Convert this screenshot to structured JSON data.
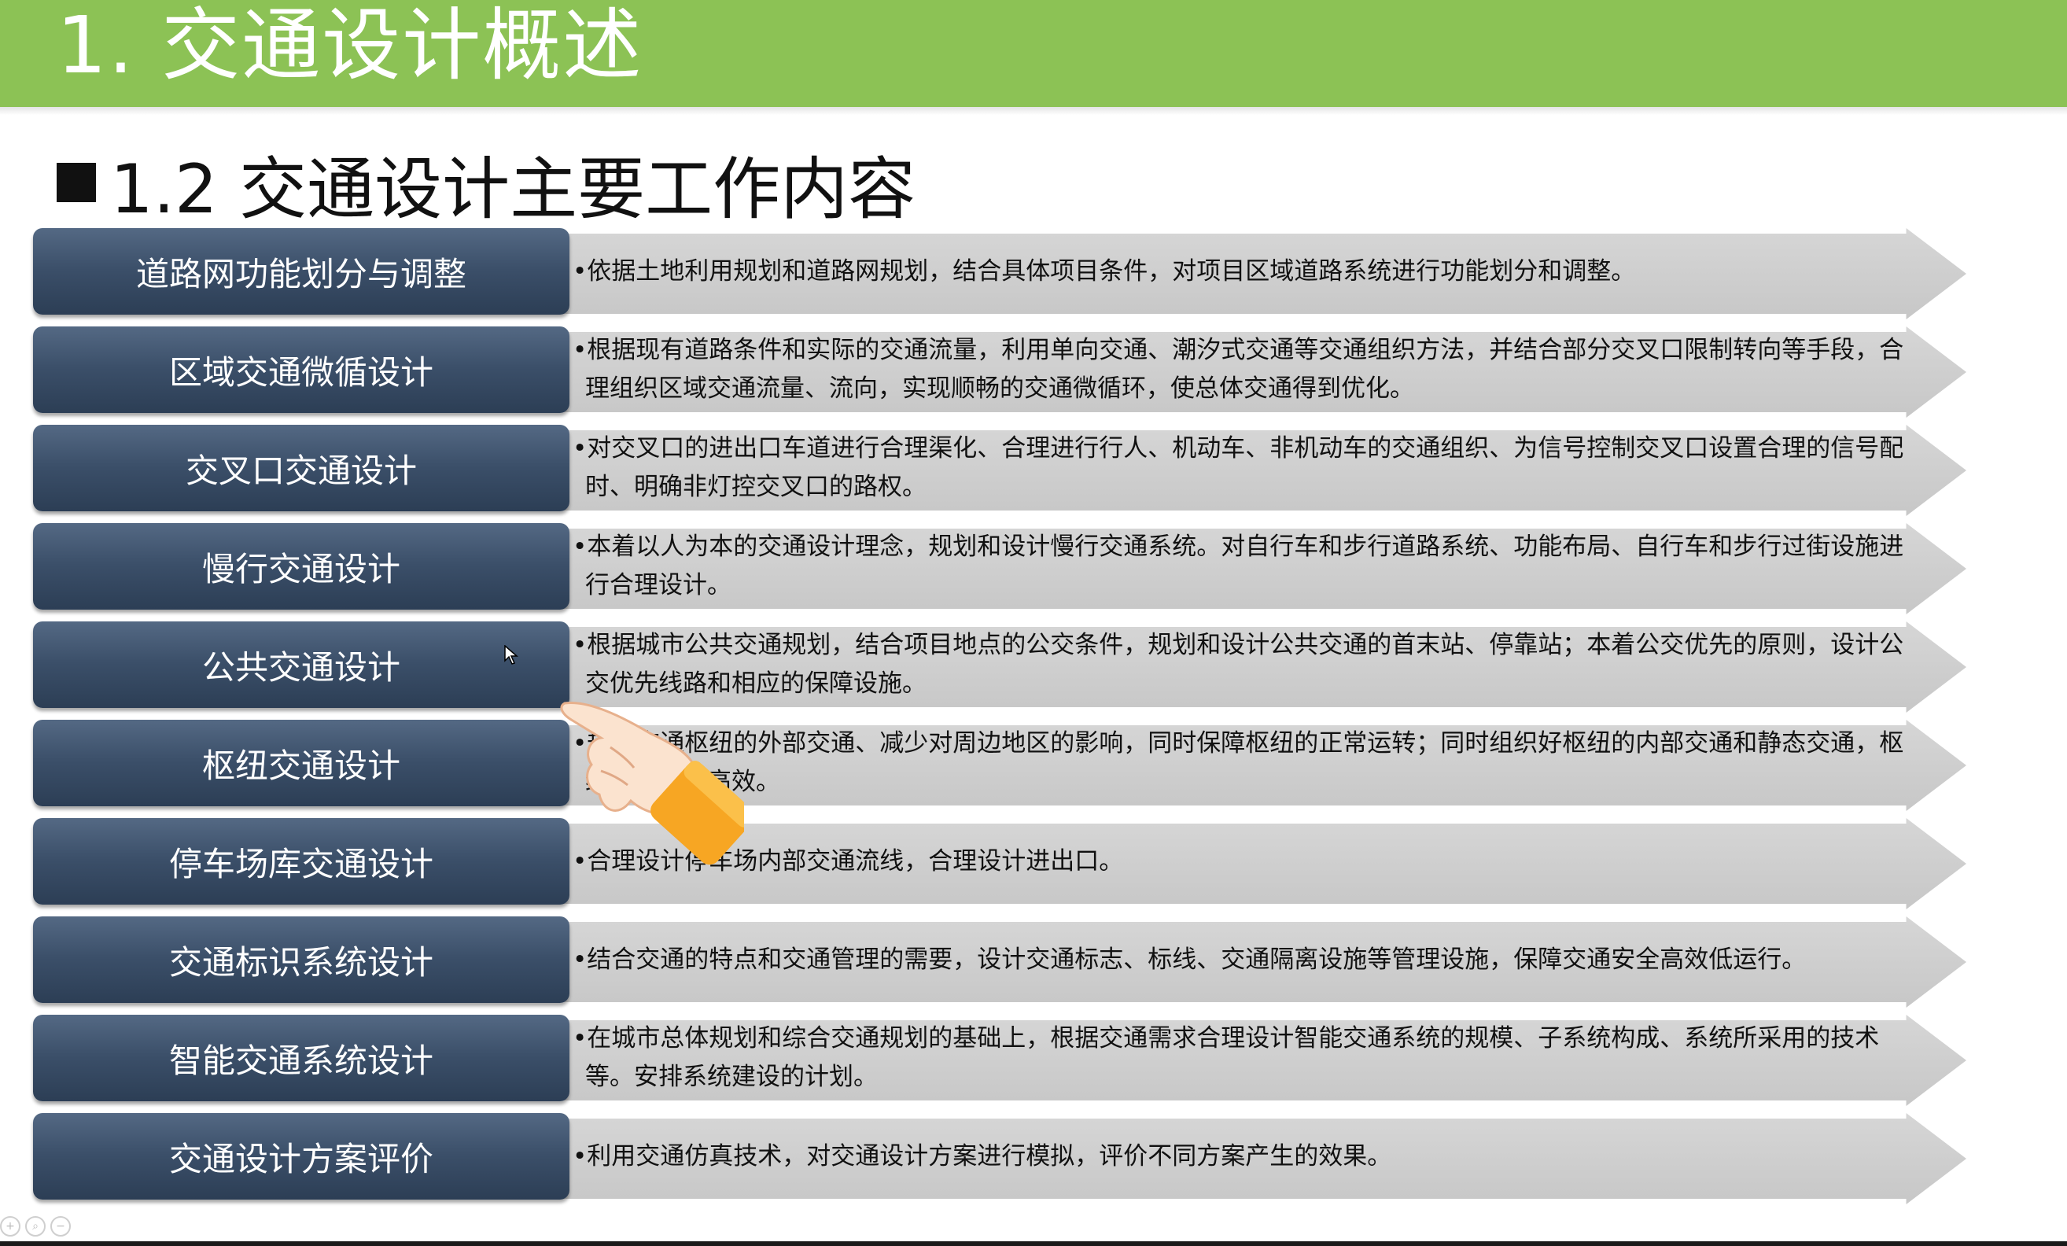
{
  "slide": {
    "header_title": "1. 交通设计概述",
    "section_title": "1.2 交通设计主要工作内容",
    "rows": [
      {
        "label": "道路网功能划分与调整",
        "desc": "•依据土地利用规划和道路网规划，结合具体项目条件，对项目区域道路系统进行功能划分和调整。"
      },
      {
        "label": "区域交通微循设计",
        "desc": "•根据现有道路条件和实际的交通流量，利用单向交通、潮汐式交通等交通组织方法，并结合部分交叉口限制转向等手段，合理组织区域交通流量、流向，实现顺畅的交通微循环，使总体交通得到优化。"
      },
      {
        "label": "交叉口交通设计",
        "desc": "•对交叉口的进出口车道进行合理渠化、合理进行行人、机动车、非机动车的交通组织、为信号控制交叉口设置合理的信号配时、明确非灯控交叉口的路权。"
      },
      {
        "label": "慢行交通设计",
        "desc": "•本着以人为本的交通设计理念，规划和设计慢行交通系统。对自行车和步行道路系统、功能布局、自行车和步行过街设施进行合理设计。"
      },
      {
        "label": "公共交通设计",
        "desc": "•根据城市公共交通规划，结合项目地点的公交条件，规划和设计公共交通的首末站、停靠站；本着公交优先的原则，设计公交优先线路和相应的保障设施。"
      },
      {
        "label": "枢纽交通设计",
        "desc": "•规划交通枢纽的外部交通、减少对周边地区的影响，同时保障枢纽的正常运转；同时组织好枢纽的内部交通和静态交通，枢纽的安全和高效。"
      },
      {
        "label": "停车场库交通设计",
        "desc": "•合理设计停车场内部交通流线，合理设计进出口。"
      },
      {
        "label": "交通标识系统设计",
        "desc": "•结合交通的特点和交通管理的需要，设计交通标志、标线、交通隔离设施等管理设施，保障交通安全高效低运行。"
      },
      {
        "label": "智能交通系统设计",
        "desc": "•在城市总体规划和综合交通规划的基础上，根据交通需求合理设计智能交通系统的规模、子系统构成、系统所采用的技术等。安排系统建设的计划。"
      },
      {
        "label": "交通设计方案评价",
        "desc": "•利用交通仿真技术，对交通设计方案进行模拟，评价不同方案产生的效果。"
      }
    ]
  },
  "overlay": {
    "pointer_icon": "hand-pointer-icon",
    "cursor_icon": "mouse-cursor-icon"
  },
  "toolbar": {
    "icons": [
      "zoom-in-icon",
      "zoom-icon",
      "zoom-out-icon"
    ],
    "zoom_in_glyph": "+",
    "zoom_glyph": "⌕",
    "zoom_out_glyph": "−"
  }
}
